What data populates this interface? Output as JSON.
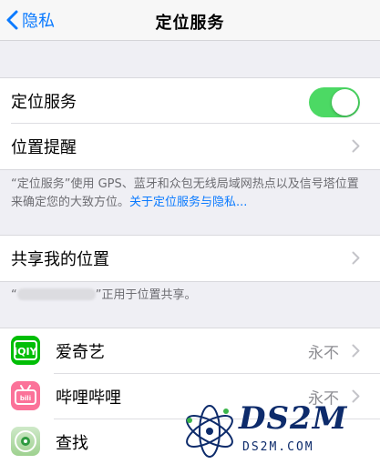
{
  "nav": {
    "back_label": "隐私",
    "title": "定位服务"
  },
  "location_group": {
    "location_services_label": "定位服务",
    "location_services_on": true,
    "location_alerts_label": "位置提醒"
  },
  "location_footer": {
    "text": "“定位服务”使用 GPS、蓝牙和众包无线局域网热点以及信号塔位置来确定您的大致方位。",
    "link": "关于定位服务与隐私..."
  },
  "share_group": {
    "share_label": "共享我的位置"
  },
  "share_footer": {
    "open_quote": "“",
    "suffix": "”正用于位置共享。"
  },
  "apps": [
    {
      "name": "爱奇艺",
      "value": "永不",
      "icon": "iqiyi-icon"
    },
    {
      "name": "哔哩哔哩",
      "value": "永不",
      "icon": "bilibili-icon"
    },
    {
      "name": "查找",
      "value": "",
      "icon": "find-my-icon"
    }
  ],
  "watermark": {
    "brand": "DS2M",
    "url": "DS2M.COM"
  },
  "colors": {
    "accent": "#0a7aff",
    "toggle_on": "#4cd964",
    "background": "#efeff4"
  }
}
